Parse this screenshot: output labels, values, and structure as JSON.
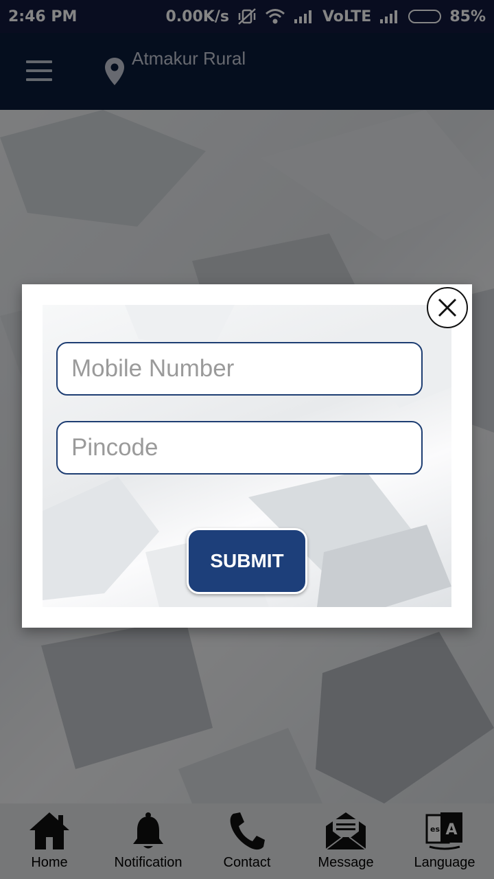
{
  "status_bar": {
    "time": "2:46 PM",
    "speed": "0.00K/s",
    "network": "VoLTE",
    "battery": "85%",
    "battery_level": 0.85,
    "icons": [
      "mute-vibrate-icon",
      "wifi-icon",
      "signal-icon",
      "signal-icon-2",
      "battery-icon"
    ]
  },
  "app_bar": {
    "menu_icon": "hamburger-menu-icon",
    "location_icon": "map-pin-icon",
    "location": "Atmakur Rural"
  },
  "modal": {
    "mobile_placeholder": "Mobile Number",
    "pincode_placeholder": "Pincode",
    "submit_label": "SUBMIT",
    "close_icon": "close-icon"
  },
  "bottom_nav": {
    "items": [
      {
        "label": "Home",
        "icon": "home-icon"
      },
      {
        "label": "Notification",
        "icon": "bell-icon"
      },
      {
        "label": "Contact",
        "icon": "phone-icon"
      },
      {
        "label": "Message",
        "icon": "envelope-icon"
      },
      {
        "label": "Language",
        "icon": "language-icon"
      }
    ]
  },
  "colors": {
    "status_bar": "#131a3f",
    "app_bar": "#0b1c3a",
    "accent": "#1d3f7a",
    "field_border": "#1d3d72"
  }
}
